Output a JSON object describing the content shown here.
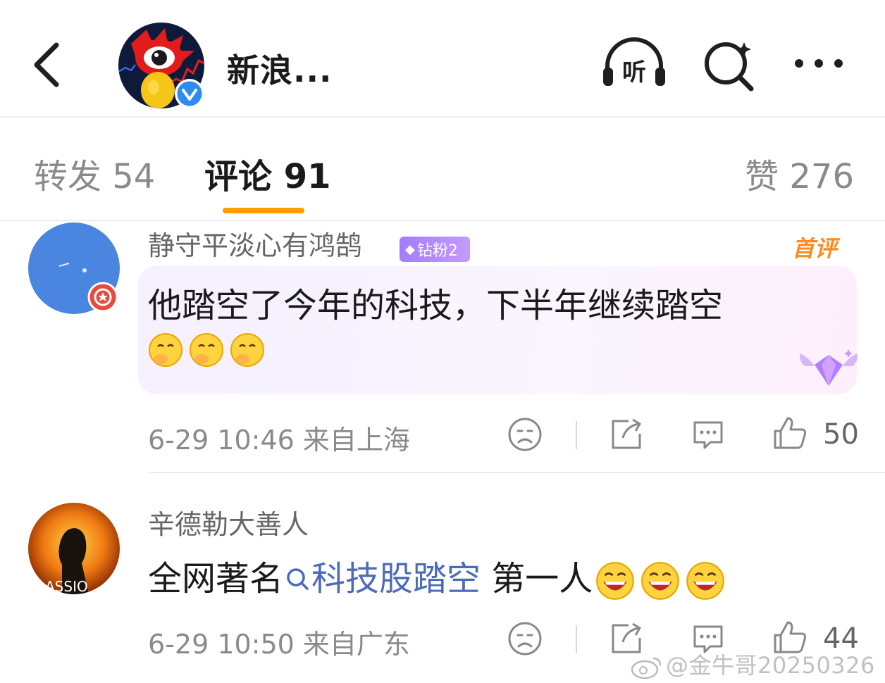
{
  "header": {
    "title": "新浪...",
    "listen_label": "听",
    "icons": [
      "back-chevron-icon",
      "headphones-listen-icon",
      "search-icon",
      "more-icon"
    ]
  },
  "tabs": {
    "repost": "转发 54",
    "comment": "评论 91",
    "like": "赞 276",
    "active_color": "#ff9d00"
  },
  "comments": [
    {
      "username": "静守平淡心有鸿鹄",
      "fan_badge": "钻粉2",
      "first_badge": "首评",
      "text": "他踏空了今年的科技，下半年继续踏空",
      "emoji": [
        "thinking-emoji",
        "thinking-emoji",
        "thinking-emoji"
      ],
      "meta": "6-29 10:46 来自上海",
      "likes": "50"
    },
    {
      "username": "辛德勒大善人",
      "text_before": "全网著名",
      "topic_link": "科技股踏空",
      "text_after": " 第一人",
      "emoji": [
        "laughing-emoji",
        "laughing-emoji",
        "laughing-emoji"
      ],
      "meta": "6-29 10:50 来自广东",
      "likes": "44",
      "avatar_text": "ASSIO"
    }
  ],
  "watermark": "@金牛哥20250326"
}
